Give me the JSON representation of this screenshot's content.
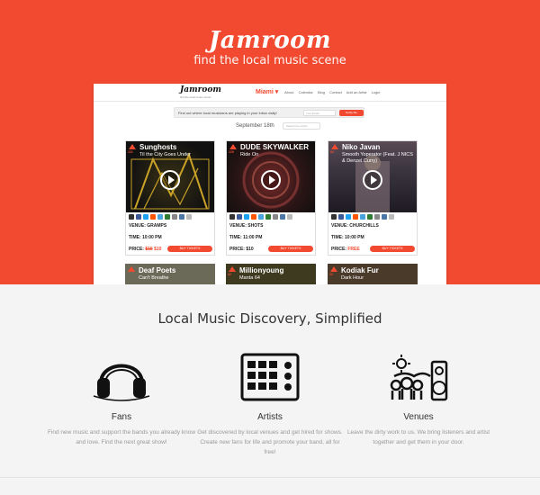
{
  "hero": {
    "brand": "Jamroom",
    "tagline": "find the local music scene",
    "bg_color": "#f24a30"
  },
  "mock_site": {
    "logo": "Jamroom",
    "logo_sub": "find the local music scene",
    "city": "Miami ▾",
    "nav": [
      "About",
      "Calendar",
      "Blog",
      "Contact",
      "Add an Artist",
      "Login"
    ],
    "signup_text": "Find out where local musicians are playing in your inbox daily!",
    "signup_placeholder": "Your Email",
    "signup_button": "Notify Me",
    "date": "September 18th",
    "date_search_placeholder": "Search the artists"
  },
  "events": [
    {
      "artist": "Sunghosts",
      "song": "Til the City Goes Under",
      "votes": "121",
      "venue": "VENUE: GRAMPS",
      "time": "TIME: 10:00 PM",
      "price_label": "PRICE:",
      "price_old": "$15",
      "price": "$10",
      "buy": "BUY TICKETS"
    },
    {
      "artist": "DUDE SKYWALKER",
      "song": "Ride On",
      "votes": "129",
      "venue": "VENUE: SHOTS",
      "time": "TIME: 11:00 PM",
      "price_label": "PRICE:",
      "price_old": "",
      "price": "$10",
      "buy": "BUY TICKETS"
    },
    {
      "artist": "Niko Javan",
      "song": "Smooth Yoperator (Feat. J NICS & Denzel Curry)",
      "votes": "84",
      "venue": "VENUE: CHURCHILLS",
      "time": "TIME: 10:00 PM",
      "price_label": "PRICE:",
      "price_old": "",
      "price": "FREE",
      "buy": "BUY TICKETS"
    }
  ],
  "events_more": [
    {
      "artist": "Deaf Poets",
      "song": "Can't Breathe",
      "votes": ""
    },
    {
      "artist": "Millionyoung",
      "song": "Manta 64",
      "votes": "42"
    },
    {
      "artist": "Kodiak Fur",
      "song": "Dark Hour",
      "votes": "23"
    }
  ],
  "features": {
    "title": "Local Music Discovery, Simplified",
    "items": [
      {
        "title": "Fans",
        "text": "Find new music and support the bands you already know and love. Find the next great show!",
        "icon": "headphones-icon"
      },
      {
        "title": "Artists",
        "text": "Get discovered by local venues and get hired for shows. Create new fans for life and promote your band, all for free!",
        "icon": "drum-machine-icon"
      },
      {
        "title": "Venues",
        "text": "Leave the dirty work to us. We bring listeners and artist together and get them in your door.",
        "icon": "venue-speaker-icon"
      }
    ]
  }
}
